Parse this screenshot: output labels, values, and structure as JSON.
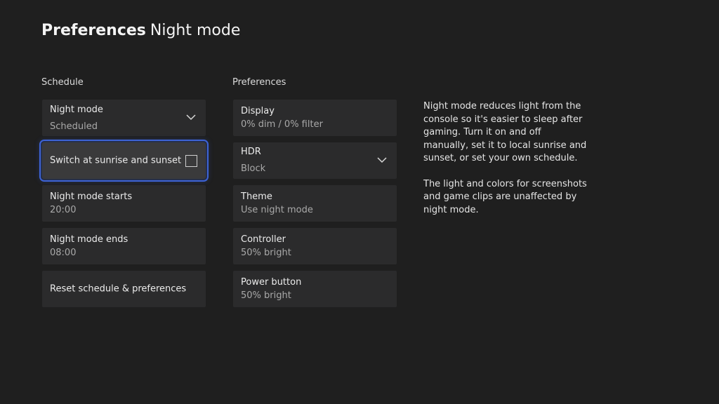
{
  "header": {
    "section": "Preferences",
    "page": "Night mode"
  },
  "schedule": {
    "label": "Schedule",
    "night_mode": {
      "title": "Night mode",
      "value": "Scheduled",
      "icon": "chevron-down-icon"
    },
    "sunrise_sunset": {
      "label": "Switch at sunrise and sunset",
      "checked": false
    },
    "starts": {
      "title": "Night mode starts",
      "value": "20:00"
    },
    "ends": {
      "title": "Night mode ends",
      "value": "08:00"
    },
    "reset": {
      "label": "Reset schedule & preferences"
    }
  },
  "preferences": {
    "label": "Preferences",
    "display": {
      "title": "Display",
      "value": "0% dim / 0% filter"
    },
    "hdr": {
      "title": "HDR",
      "value": "Block",
      "icon": "chevron-down-icon"
    },
    "theme": {
      "title": "Theme",
      "value": "Use night mode"
    },
    "controller": {
      "title": "Controller",
      "value": "50% bright"
    },
    "power_button": {
      "title": "Power button",
      "value": "50% bright"
    }
  },
  "info": {
    "paragraph1": "Night mode reduces light from the console so it's easier to sleep after gaming. Turn it on and off manually, set it to local sunrise and sunset, or set your own schedule.",
    "paragraph2": "The light and colors for screenshots and game clips are unaffected by night mode."
  },
  "colors": {
    "background": "#1f1f1f",
    "tile": "#2b2b2c",
    "focus_tile": "#3a3a3b",
    "focus_accent": "#3d63d6"
  }
}
